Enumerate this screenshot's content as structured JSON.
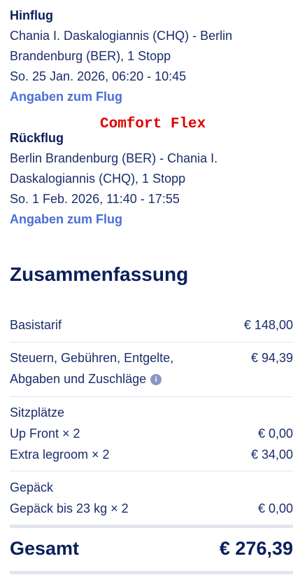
{
  "outbound": {
    "heading": "Hinflug",
    "route_line1": "Chania I. Daskalogiannis (CHQ) - Berlin",
    "route_line2": "Brandenburg (BER), 1 Stopp",
    "datetime": "So. 25 Jan. 2026, 06:20 - 10:45",
    "details_link": "Angaben zum Flug"
  },
  "fare_label": "Comfort Flex",
  "return": {
    "heading": "Rückflug",
    "route_line1": "Berlin Brandenburg (BER) - Chania I.",
    "route_line2": "Daskalogiannis (CHQ), 1 Stopp",
    "datetime": "So. 1 Feb. 2026, 11:40 - 17:55",
    "details_link": "Angaben zum Flug"
  },
  "summary": {
    "title": "Zusammenfassung",
    "base_fare": {
      "label": "Basistarif",
      "amount": "€ 148,00"
    },
    "taxes": {
      "label_line1": "Steuern, Gebühren, Entgelte,",
      "label_line2": "Abgaben und Zuschläge",
      "amount": "€ 94,39",
      "info_icon": "i"
    },
    "seats": {
      "heading": "Sitzplätze",
      "items": [
        {
          "label": "Up Front × 2",
          "amount": "€ 0,00"
        },
        {
          "label": "Extra legroom × 2",
          "amount": "€ 34,00"
        }
      ]
    },
    "baggage": {
      "heading": "Gepäck",
      "items": [
        {
          "label": "Gepäck bis 23 kg × 2",
          "amount": "€ 0,00"
        }
      ]
    },
    "total": {
      "label": "Gesamt",
      "amount": "€ 276,39"
    }
  },
  "colors": {
    "navy": "#0a1f5c",
    "link": "#4a6fd6",
    "overlay_red": "#e00000",
    "divider": "#e3e6ee"
  }
}
